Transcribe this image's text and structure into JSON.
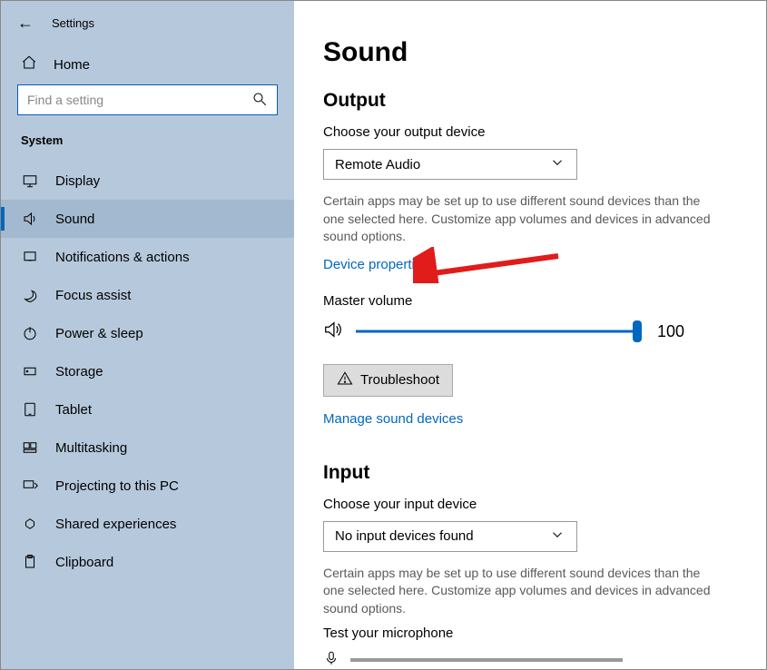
{
  "app": {
    "title": "Settings"
  },
  "sidebar": {
    "home_label": "Home",
    "search_placeholder": "Find a setting",
    "group_label": "System",
    "items": [
      {
        "label": "Display",
        "icon": "display-icon"
      },
      {
        "label": "Sound",
        "icon": "sound-icon",
        "selected": true
      },
      {
        "label": "Notifications & actions",
        "icon": "notifications-icon"
      },
      {
        "label": "Focus assist",
        "icon": "focus-assist-icon"
      },
      {
        "label": "Power & sleep",
        "icon": "power-icon"
      },
      {
        "label": "Storage",
        "icon": "storage-icon"
      },
      {
        "label": "Tablet",
        "icon": "tablet-icon"
      },
      {
        "label": "Multitasking",
        "icon": "multitasking-icon"
      },
      {
        "label": "Projecting to this PC",
        "icon": "projecting-icon"
      },
      {
        "label": "Shared experiences",
        "icon": "shared-icon"
      },
      {
        "label": "Clipboard",
        "icon": "clipboard-icon"
      }
    ]
  },
  "main": {
    "page_title": "Sound",
    "output": {
      "heading": "Output",
      "choose_label": "Choose your output device",
      "selected_device": "Remote Audio",
      "help_text": "Certain apps may be set up to use different sound devices than the one selected here. Customize app volumes and devices in advanced sound options.",
      "device_properties_link": "Device properties",
      "master_label": "Master volume",
      "master_value": "100",
      "troubleshoot_label": "Troubleshoot",
      "manage_link": "Manage sound devices"
    },
    "input": {
      "heading": "Input",
      "choose_label": "Choose your input device",
      "selected_device": "No input devices found",
      "help_text": "Certain apps may be set up to use different sound devices than the one selected here. Customize app volumes and devices in advanced sound options.",
      "test_label": "Test your microphone"
    }
  },
  "annotation": {
    "target": "device-properties-link",
    "color": "#e21b1b"
  }
}
